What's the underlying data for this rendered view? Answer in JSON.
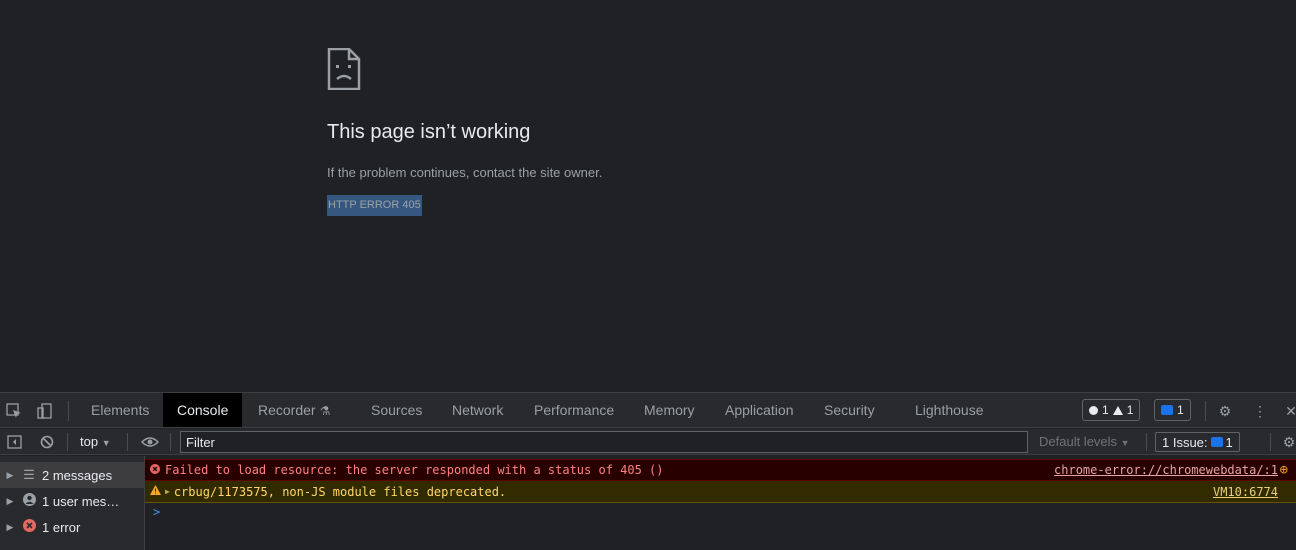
{
  "page": {
    "icon": "sad-document-icon",
    "title": "This page isn’t working",
    "description": "If the problem continues, contact the site owner.",
    "error_code": "HTTP ERROR 405"
  },
  "devtools": {
    "tabs": [
      {
        "label": "Elements",
        "active": false
      },
      {
        "label": "Console",
        "active": true
      },
      {
        "label": "Recorder",
        "active": false
      },
      {
        "label": "Sources",
        "active": false
      },
      {
        "label": "Network",
        "active": false
      },
      {
        "label": "Performance",
        "active": false
      },
      {
        "label": "Memory",
        "active": false
      },
      {
        "label": "Application",
        "active": false
      },
      {
        "label": "Security",
        "active": false
      },
      {
        "label": "Lighthouse",
        "active": false
      }
    ],
    "counts": {
      "errors": "1",
      "warnings": "1",
      "messages": "1"
    },
    "toolbar": {
      "context": "top",
      "filter_placeholder": "Filter",
      "levels": "Default levels",
      "issues_label": "1 Issue:",
      "issues_count": "1"
    },
    "sidebar": [
      {
        "label": "2 messages",
        "icon": "list-icon",
        "selected": true
      },
      {
        "label": "1 user mes…",
        "icon": "user-icon",
        "selected": false
      },
      {
        "label": "1 error",
        "icon": "error-icon",
        "selected": false
      }
    ],
    "messages": [
      {
        "level": "error",
        "text": "Failed to load resource: the server responded with a status of 405 ()",
        "source": "chrome-error://chromewebdata/:1"
      },
      {
        "level": "warning",
        "text": "crbug/1173575, non-JS module files deprecated.",
        "source": "VM10:6774"
      }
    ],
    "prompt": ">"
  },
  "colors": {
    "background": "#202124",
    "error_bg": "#290000",
    "warning_bg": "#332b00",
    "highlight": "#365880",
    "active_tab": "#000000"
  }
}
